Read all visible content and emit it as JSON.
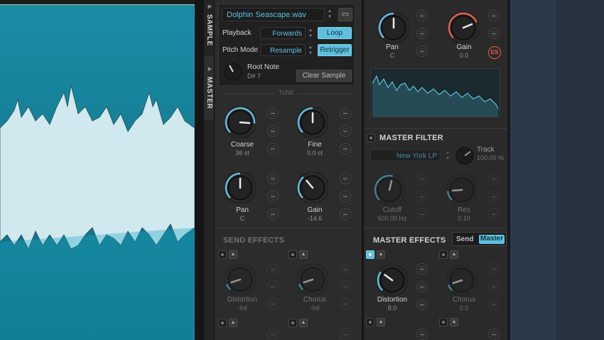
{
  "colors": {
    "accent": "#5ec0de",
    "waveform": "#0e6f83",
    "warn": "#e0604f"
  },
  "tabs": {
    "sample": "SAMPLE",
    "master": "MASTER"
  },
  "sample": {
    "filename": "Dolphin Seascape.wav",
    "playback_label": "Playback",
    "playback_value": "Forwards",
    "loop_label": "Loop",
    "pitch_mode_label": "Pitch Mode",
    "pitch_mode_value": "Resample",
    "retrigger_label": "Retrigger",
    "root_note_label": "Root Note",
    "root_note_value": "D# 7",
    "clear_sample_label": "Clear Sample"
  },
  "tune": {
    "section_label": "TUNE",
    "knobs": [
      {
        "label": "Coarse",
        "value": "36 st",
        "level": 0.85
      },
      {
        "label": "Fine",
        "value": "0.0 ct",
        "level": 0.5
      },
      {
        "label": "Pan",
        "value": "C",
        "level": 0.5
      },
      {
        "label": "Gain",
        "value": "-14.6",
        "level": 0.35
      }
    ]
  },
  "send_effects": {
    "title": "SEND EFFECTS",
    "knobs": [
      {
        "label": "Distortion",
        "value": "-Inf",
        "level": 0.1
      },
      {
        "label": "Chorus",
        "value": "-Inf",
        "level": 0.1
      }
    ]
  },
  "master": {
    "knobs": [
      {
        "label": "Pan",
        "value": "C",
        "level": 0.5
      },
      {
        "label": "Gain",
        "value": "0.0",
        "level": 0.75
      }
    ],
    "es_badge": "ES"
  },
  "master_filter": {
    "title": "MASTER FILTER",
    "type_value": "New York LP",
    "track_label": "Track",
    "track_value": "100.00 %",
    "knobs": [
      {
        "label": "Cutoff",
        "value": "600.00 Hz",
        "level": 0.55
      },
      {
        "label": "Res",
        "value": "0.10",
        "level": 0.15
      }
    ]
  },
  "master_effects": {
    "title": "MASTER EFFECTS",
    "toggle_send": "Send",
    "toggle_master": "Master",
    "knobs": [
      {
        "label": "Distortion",
        "value": "8.0",
        "level": 0.3
      },
      {
        "label": "Chorus",
        "value": "0.0",
        "level": 0.1
      }
    ]
  }
}
